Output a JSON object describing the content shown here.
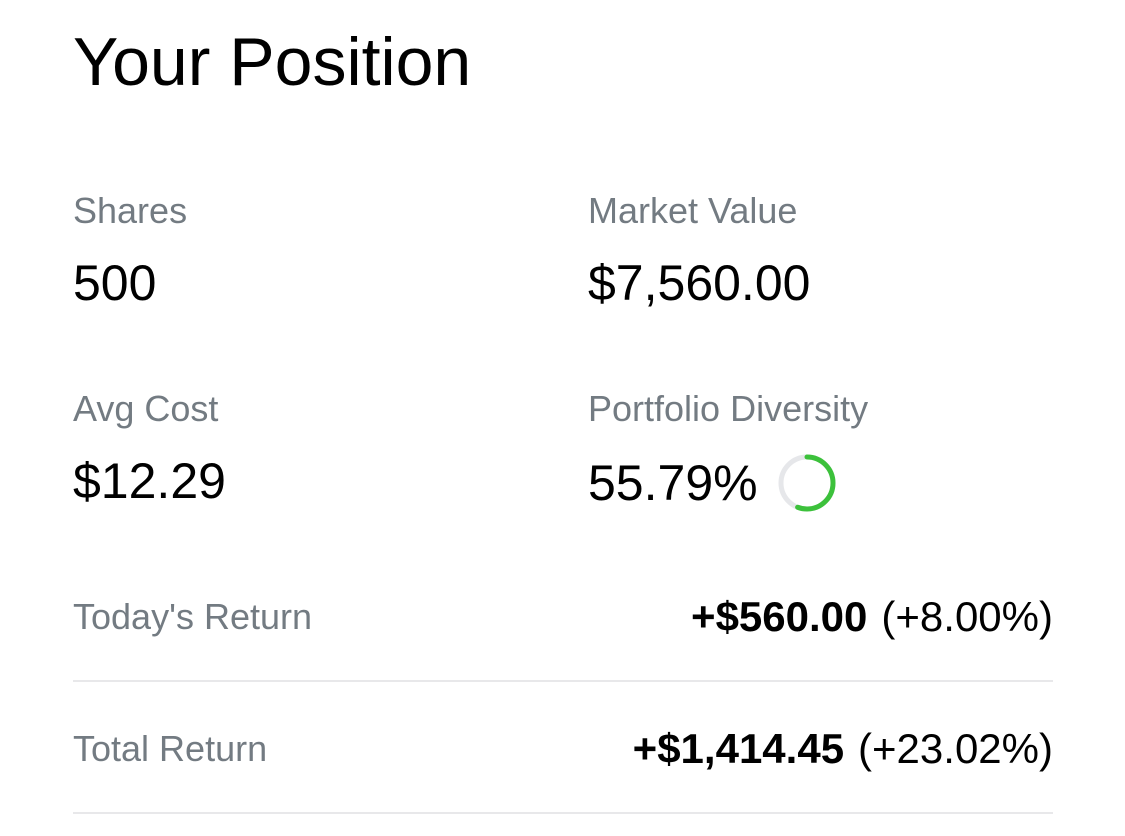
{
  "position": {
    "title": "Your Position",
    "shares": {
      "label": "Shares",
      "value": "500"
    },
    "market_value": {
      "label": "Market Value",
      "value": "$7,560.00"
    },
    "avg_cost": {
      "label": "Avg Cost",
      "value": "$12.29"
    },
    "portfolio_diversity": {
      "label": "Portfolio Diversity",
      "value": "55.79%",
      "ring_fraction": 0.5579,
      "ring_icon": "progress-ring-icon",
      "ring_color": "#3cc13b",
      "ring_track_color": "#e6e7ea"
    },
    "todays_return": {
      "label": "Today's Return",
      "amount": "+$560.00",
      "percent": "(+8.00%)"
    },
    "total_return": {
      "label": "Total Return",
      "amount": "+$1,414.45",
      "percent": "(+23.02%)"
    }
  },
  "colors": {
    "label": "#737b82",
    "value": "#000000",
    "divider": "#e8e8ea"
  }
}
